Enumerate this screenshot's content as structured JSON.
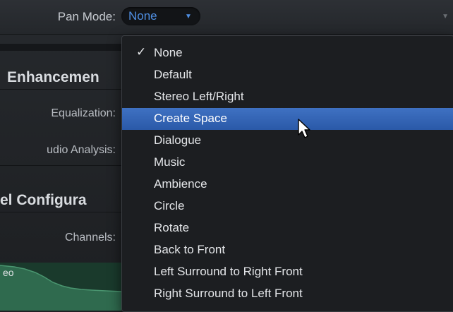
{
  "pan": {
    "label": "Pan Mode:",
    "value": "None"
  },
  "sections": {
    "enhancements_title": "Enhancemen",
    "equalization_label": "Equalization:",
    "audio_analysis_label": "udio Analysis:",
    "channel_config_title": "el Configura",
    "channels_label": "Channels:",
    "waveform_label": "eo"
  },
  "menu": {
    "selected": "None",
    "highlighted": "Create Space",
    "items": [
      "None",
      "Default",
      "Stereo Left/Right",
      "Create Space",
      "Dialogue",
      "Music",
      "Ambience",
      "Circle",
      "Rotate",
      "Back to Front",
      "Left Surround to Right Front",
      "Right Surround to Left Front"
    ]
  },
  "colors": {
    "accent": "#4f8fe3",
    "highlight": "#3566b8",
    "waveform": "#2f6a4e"
  },
  "icons": {
    "check": "checkmark-icon",
    "popup_arrow": "triangle-down-icon",
    "cursor": "mouse-pointer-icon"
  }
}
